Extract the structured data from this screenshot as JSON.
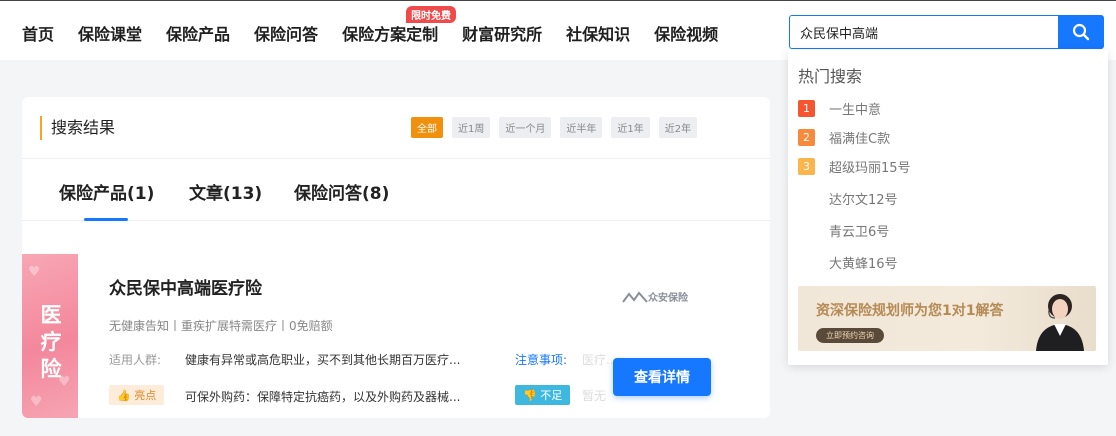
{
  "nav": {
    "items": [
      "首页",
      "保险课堂",
      "保险产品",
      "保险问答",
      "保险方案定制",
      "财富研究所",
      "社保知识",
      "保险视频"
    ],
    "badge": "限时免费"
  },
  "search": {
    "value": "众民保中高端"
  },
  "results": {
    "title": "搜索结果",
    "filters": [
      "全部",
      "近1周",
      "近一个月",
      "近半年",
      "近1年",
      "近2年"
    ],
    "active_filter": "全部",
    "tabs": [
      "保险产品(1)",
      "文章(13)",
      "保险问答(8)"
    ],
    "active_tab": "保险产品(1)"
  },
  "product": {
    "thumb_text": "医疗险",
    "name": "众民保中高端医疗险",
    "tags": "无健康告知丨重疾扩展特需医疗丨0免赔额",
    "audience_label": "适用人群:",
    "audience_value": "健康有异常或高危职业，买不到其他长期百万医疗...",
    "note_label": "注意事项:",
    "note_value": "医疗...",
    "highlight_label": "亮点",
    "highlight_value": "可保外购药：保障特定抗癌药，以及外购药及器械...",
    "shortfall_label": "不足",
    "shortfall_value": "暂无",
    "brand": "众安保险",
    "detail_button": "查看详情"
  },
  "hot_search": {
    "title": "热门搜索",
    "items": [
      {
        "rank": "1",
        "label": "一生中意"
      },
      {
        "rank": "2",
        "label": "福满佳C款"
      },
      {
        "rank": "3",
        "label": "超级玛丽15号"
      },
      {
        "rank": "",
        "label": "达尔文12号"
      },
      {
        "rank": "",
        "label": "青云卫6号"
      },
      {
        "rank": "",
        "label": "大黄蜂16号"
      }
    ],
    "banner_text": "资深保险规划师为您1对1解答",
    "banner_button": "立即预约咨询"
  },
  "colors": {
    "accent": "#1677ff",
    "orange": "#f0900d",
    "pink": "#f3879b"
  },
  "icons": [
    "search-icon",
    "thumb-up-icon",
    "thumb-down-icon",
    "brand-logo-icon"
  ]
}
